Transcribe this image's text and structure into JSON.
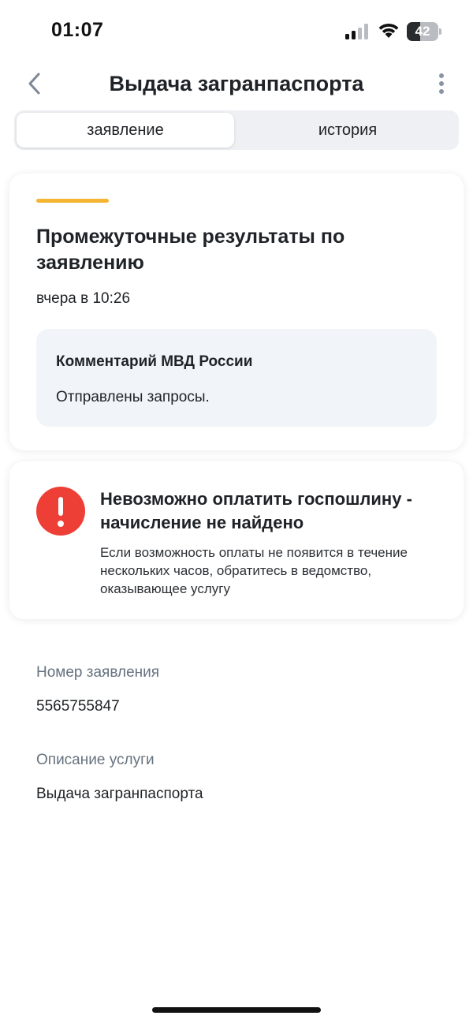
{
  "status_bar": {
    "time": "01:07",
    "battery_level": "42",
    "battery_fraction": 0.42
  },
  "header": {
    "title": "Выдача загранпаспорта",
    "back_icon": "chevron-left-icon",
    "more_icon": "more-vertical-icon"
  },
  "tabs": [
    {
      "label": "заявление",
      "active": true
    },
    {
      "label": "история",
      "active": false
    }
  ],
  "result_card": {
    "title": "Промежуточные результаты по заявлению",
    "date": "вчера в 10:26",
    "accent_color": "#f4b533",
    "comment": {
      "title": "Комментарий МВД России",
      "text": "Отправлены запросы."
    }
  },
  "warning_card": {
    "icon": "exclamation-icon",
    "icon_color": "#ee3f36",
    "title": "Невозможно оплатить госпошлину - начисление не найдено",
    "text": "Если возможность оплаты не появится в течение нескольких часов, обратитесь в ведомство, оказывающее услугу"
  },
  "details": {
    "number_label": "Номер заявления",
    "number_value": "5565755847",
    "description_label": "Описание услуги",
    "description_value": "Выдача загранпаспорта"
  }
}
